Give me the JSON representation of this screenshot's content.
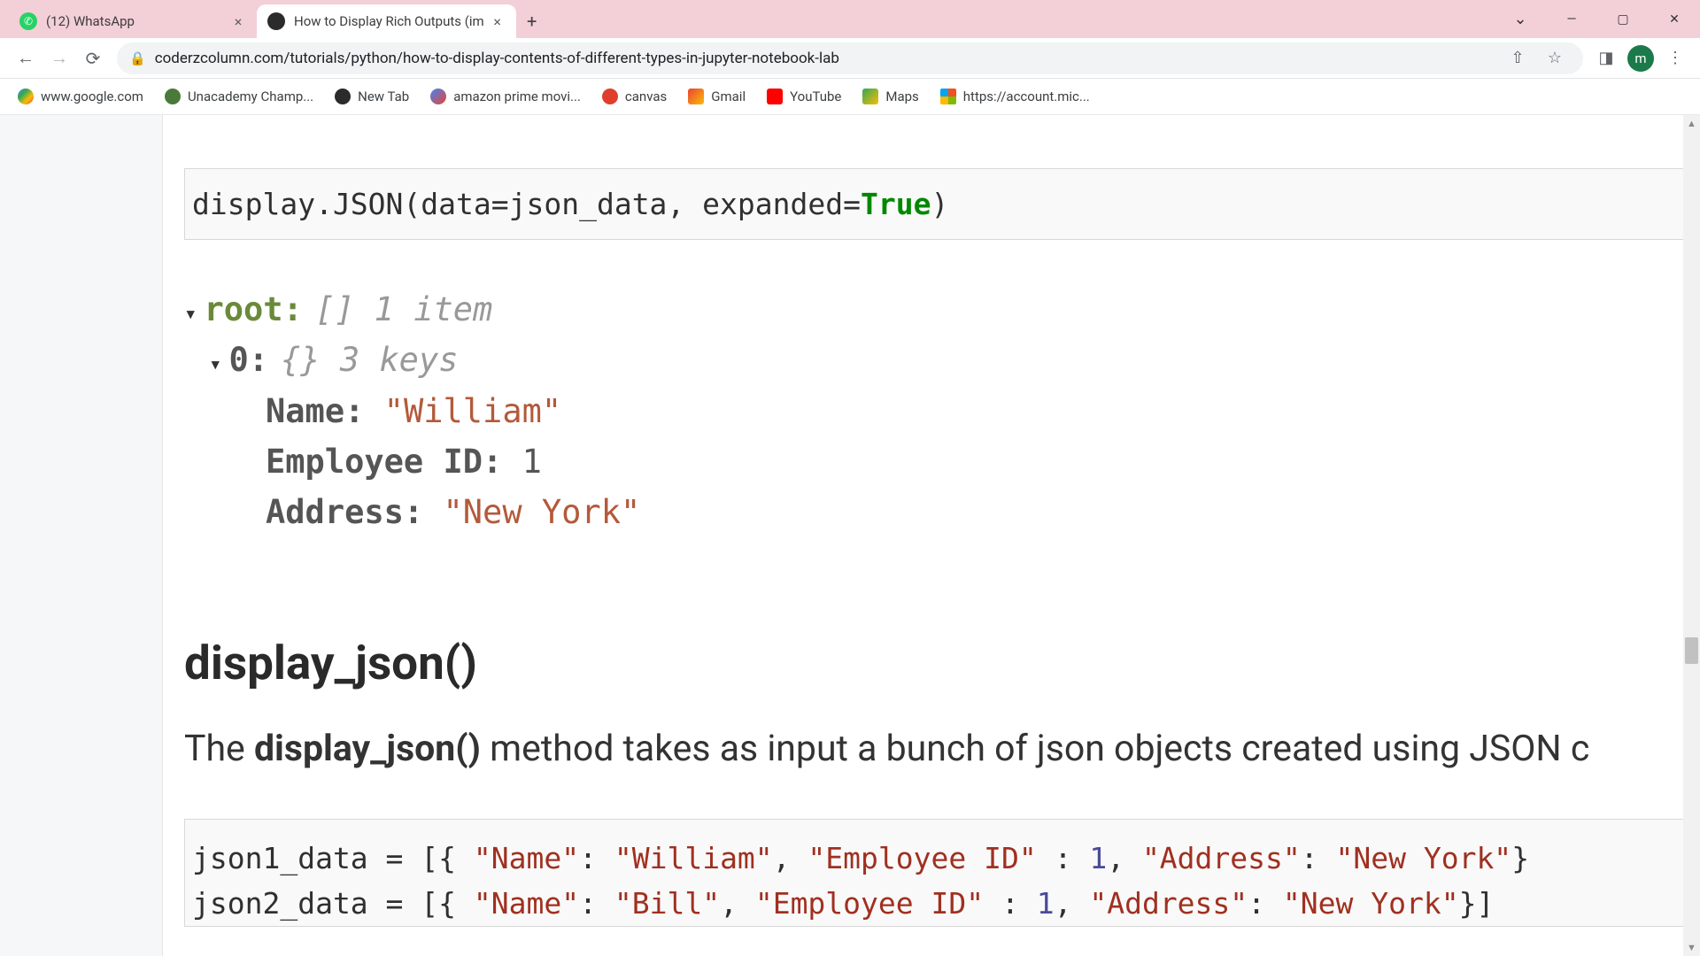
{
  "tabs": [
    {
      "title": "(12) WhatsApp",
      "active": false
    },
    {
      "title": "How to Display Rich Outputs (im",
      "active": true
    }
  ],
  "url": "coderzcolumn.com/tutorials/python/how-to-display-contents-of-different-types-in-jupyter-notebook-lab",
  "bookmarks": [
    {
      "label": "www.google.com"
    },
    {
      "label": "Unacademy Champ..."
    },
    {
      "label": "New Tab"
    },
    {
      "label": "amazon prime movi..."
    },
    {
      "label": "canvas"
    },
    {
      "label": "Gmail"
    },
    {
      "label": "YouTube"
    },
    {
      "label": "Maps"
    },
    {
      "label": "https://account.mic..."
    }
  ],
  "avatar_letter": "m",
  "code1": {
    "prefix": "display.JSON(data=json_data, expanded=",
    "kw": "True",
    "suffix": ")"
  },
  "jsontree": {
    "root_key": "root:",
    "root_type": "[] 1 item",
    "idx_key": "0:",
    "idx_type": "{} 3 keys",
    "f1_key": "Name:",
    "f1_val": "\"William\"",
    "f2_key": "Employee ID:",
    "f2_val": "1",
    "f3_key": "Address:",
    "f3_val": "\"New York\""
  },
  "heading": "display_json()",
  "para_pre": "The ",
  "para_strong": "display_json()",
  "para_post": " method takes as input a bunch of json objects created using JSON c",
  "code2": {
    "l1_a": "json1_data = [{ ",
    "l1_k1": "\"Name\"",
    "l1_c1": ": ",
    "l1_v1": "\"William\"",
    "l1_c2": ", ",
    "l1_k2": "\"Employee ID\"",
    "l1_c3": " : ",
    "l1_v2": "1",
    "l1_c4": ", ",
    "l1_k3": "\"Address\"",
    "l1_c5": ": ",
    "l1_v3": "\"New York\"",
    "l1_end": "}",
    "l2_a": "json2_data = [{ ",
    "l2_k1": "\"Name\"",
    "l2_c1": ": ",
    "l2_v1": "\"Bill\"",
    "l2_c2": ", ",
    "l2_k2": "\"Employee ID\"",
    "l2_c3": " : ",
    "l2_v2": "1",
    "l2_c4": ", ",
    "l2_k3": "\"Address\"",
    "l2_c5": ": ",
    "l2_v3": "\"New York\"",
    "l2_end": "}]"
  }
}
